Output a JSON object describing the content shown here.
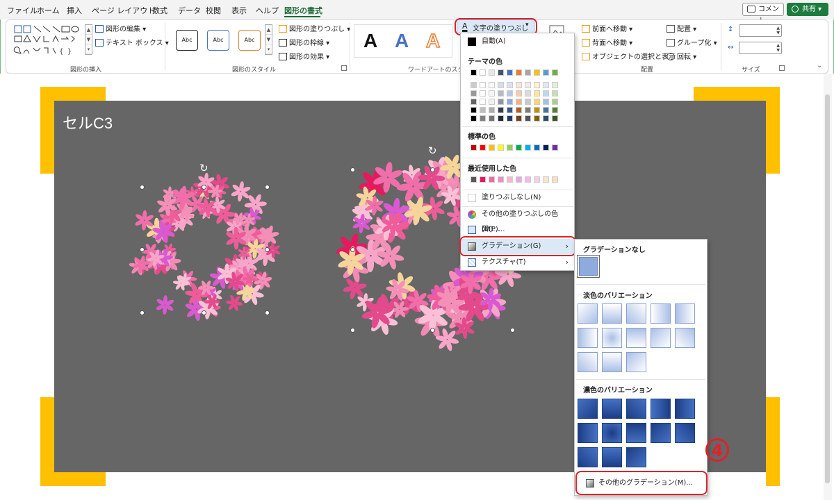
{
  "menu": {
    "tabs": [
      "ファイル",
      "ホーム",
      "挿入",
      "ページ レイアウト",
      "数式",
      "データ",
      "校閲",
      "表示",
      "ヘルプ",
      "図形の書式"
    ],
    "active_tab": "図形の書式",
    "comment_label": "コメント",
    "share_label": "共有"
  },
  "ribbon": {
    "insert_shapes": {
      "edit_shape_label": "図形の編集",
      "text_box_label": "テキスト ボックス",
      "group_label": "図形の挿入"
    },
    "shape_styles": {
      "preset_labels": [
        "Abc",
        "Abc",
        "Abc"
      ],
      "fill_label": "図形の塗りつぶし",
      "outline_label": "図形の枠線",
      "effects_label": "図形の効果",
      "group_label": "図形のスタイル"
    },
    "wordart": {
      "letters": [
        "A",
        "A",
        "A"
      ],
      "text_fill_label": "文字の塗りつぶし",
      "group_label": "ワードアートのスタイル"
    },
    "arrange": {
      "bring_forward_label": "前面へ移動",
      "send_backward_label": "背面へ移動",
      "selection_pane_label": "オブジェクトの選択と表示",
      "align_label": "配置",
      "group_label": "グループ化",
      "rotate_label": "回転",
      "section_label": "配置"
    },
    "size": {
      "group_label": "サイズ"
    }
  },
  "slide": {
    "title": "セルC3",
    "colors": {
      "background": "#666666",
      "corner": "#ffc000"
    }
  },
  "fill_dropdown": {
    "automatic_label": "自動(A)",
    "theme_colors_label": "テーマの色",
    "theme_colors": [
      "#000000",
      "#ffffff",
      "#e7e6e6",
      "#44546a",
      "#4472c4",
      "#ed7d31",
      "#a5a5a5",
      "#ffc000",
      "#5b9bd5",
      "#70ad47"
    ],
    "standard_colors_label": "標準の色",
    "standard_colors": [
      "#c00000",
      "#ff0000",
      "#ffc000",
      "#ffff00",
      "#92d050",
      "#00b050",
      "#00b0f0",
      "#0070c0",
      "#002060",
      "#7030a0"
    ],
    "recent_colors_label": "最近使用した色",
    "recent_colors": [
      "#595959",
      "#e8185f",
      "#f26b9c",
      "#ee8ec4",
      "#f5b8d4",
      "#e6a9e6",
      "#f9b6ef",
      "#f6d2e6",
      "#f4e8c8",
      "#f9e0c4"
    ],
    "no_fill_label": "塗りつぶしなし(N)",
    "more_colors_label": "その他の塗りつぶしの色(M)...",
    "picture_label": "図(P)...",
    "gradient_label": "グラデーション(G)",
    "texture_label": "テクスチャ(T)"
  },
  "gradient_submenu": {
    "no_gradient_label": "グラデーションなし",
    "light_variations_label": "淡色のバリエーション",
    "dark_variations_label": "濃色のバリエーション",
    "more_gradients_label": "その他のグラデーション(M)...",
    "base_color": "#4472c4"
  },
  "annotation": {
    "step_number": "4",
    "highlight_color": "#e0212a"
  }
}
